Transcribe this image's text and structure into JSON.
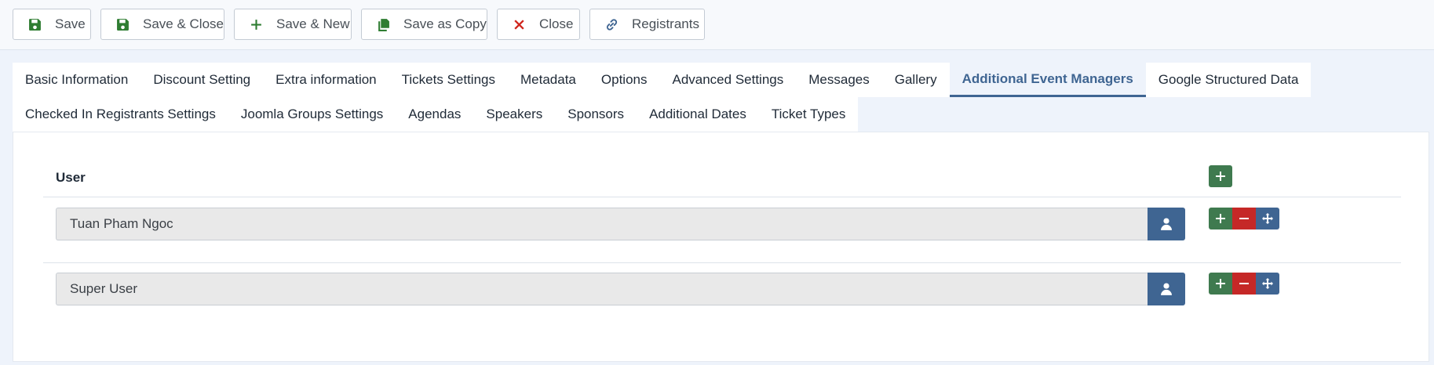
{
  "toolbar": {
    "buttons": [
      {
        "label": "Save",
        "icon": "floppy-icon"
      },
      {
        "label": "Save & Close",
        "icon": "floppy-icon"
      },
      {
        "label": "Save & New",
        "icon": "plus-icon"
      },
      {
        "label": "Save as Copy",
        "icon": "copy-icon"
      },
      {
        "label": "Close",
        "icon": "x-icon"
      },
      {
        "label": "Registrants",
        "icon": "link-icon"
      }
    ]
  },
  "tabs": {
    "row1": [
      "Basic Information",
      "Discount Setting",
      "Extra information",
      "Tickets Settings",
      "Metadata",
      "Options",
      "Advanced Settings",
      "Messages",
      "Gallery",
      "Additional Event Managers",
      "Google Structured Data"
    ],
    "row2": [
      "Checked In Registrants Settings",
      "Joomla Groups Settings",
      "Agendas",
      "Speakers",
      "Sponsors",
      "Additional Dates",
      "Ticket Types"
    ],
    "active": "Additional Event Managers"
  },
  "managers": {
    "column_header": "User",
    "rows": [
      {
        "user": "Tuan Pham Ngoc"
      },
      {
        "user": "Super User"
      }
    ]
  },
  "colors": {
    "green": "#3f7a4f",
    "red": "#c52827",
    "blue": "#3f6592",
    "icon_green": "#2f7d32",
    "icon_red": "#d0261d",
    "icon_blue": "#3f6592"
  }
}
